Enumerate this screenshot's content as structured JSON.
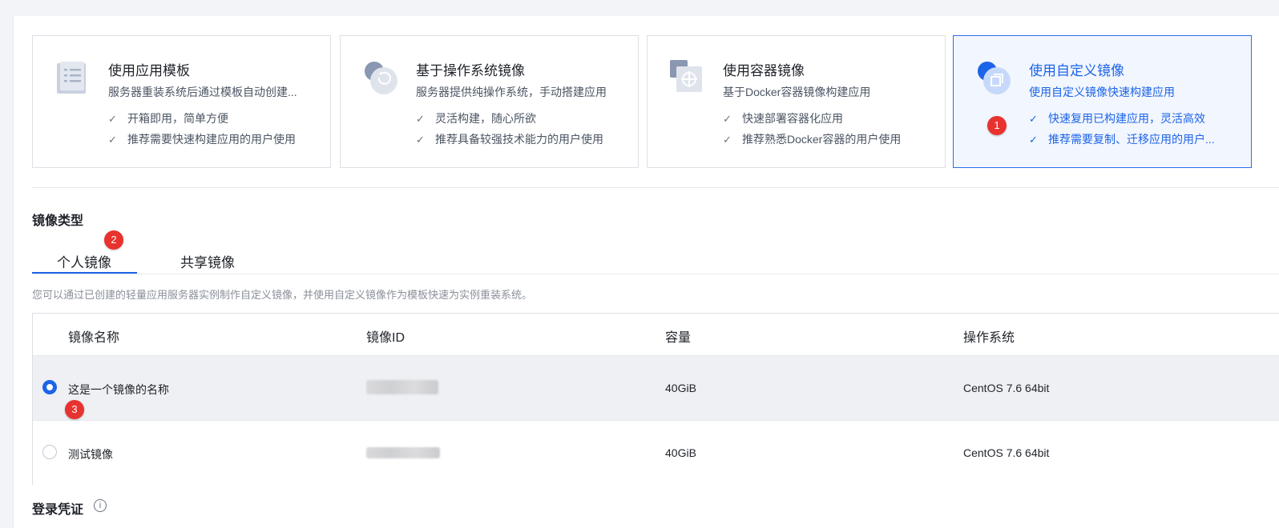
{
  "cards": [
    {
      "title": "使用应用模板",
      "desc": "服务器重装系统后通过模板自动创建...",
      "features": [
        "开箱即用，简单方便",
        "推荐需要快速构建应用的用户使用"
      ],
      "icon": "template-icon"
    },
    {
      "title": "基于操作系统镜像",
      "desc": "服务器提供纯操作系统，手动搭建应用",
      "features": [
        "灵活构建，随心所欲",
        "推荐具备较强技术能力的用户使用"
      ],
      "icon": "os-image-icon"
    },
    {
      "title": "使用容器镜像",
      "desc": "基于Docker容器镜像构建应用",
      "features": [
        "快速部署容器化应用",
        "推荐熟悉Docker容器的用户使用"
      ],
      "icon": "container-icon"
    },
    {
      "title": "使用自定义镜像",
      "desc": "使用自定义镜像快速构建应用",
      "features": [
        "快速复用已构建应用，灵活高效",
        "推荐需要复制、迁移应用的用户..."
      ],
      "icon": "custom-image-icon",
      "selected": true
    }
  ],
  "markers": [
    "1",
    "2",
    "3"
  ],
  "image_type": {
    "title": "镜像类型",
    "tabs": [
      "个人镜像",
      "共享镜像"
    ],
    "active_tab": "个人镜像",
    "hint": "您可以通过已创建的轻量应用服务器实例制作自定义镜像，并使用自定义镜像作为模板快速为实例重装系统。"
  },
  "table": {
    "headers": [
      "镜像名称",
      "镜像ID",
      "容量",
      "操作系统"
    ],
    "rows": [
      {
        "name": "这是一个镜像的名称",
        "capacity": "40GiB",
        "os": "CentOS 7.6 64bit",
        "selected": true
      },
      {
        "name": "测试镜像",
        "capacity": "40GiB",
        "os": "CentOS 7.6 64bit",
        "selected": false
      }
    ]
  },
  "login": {
    "title": "登录凭证",
    "info_icon": "info-icon"
  },
  "colors": {
    "accent": "#1c64e8",
    "marker": "#e8322f",
    "selected_bg": "#f2f6fe"
  }
}
